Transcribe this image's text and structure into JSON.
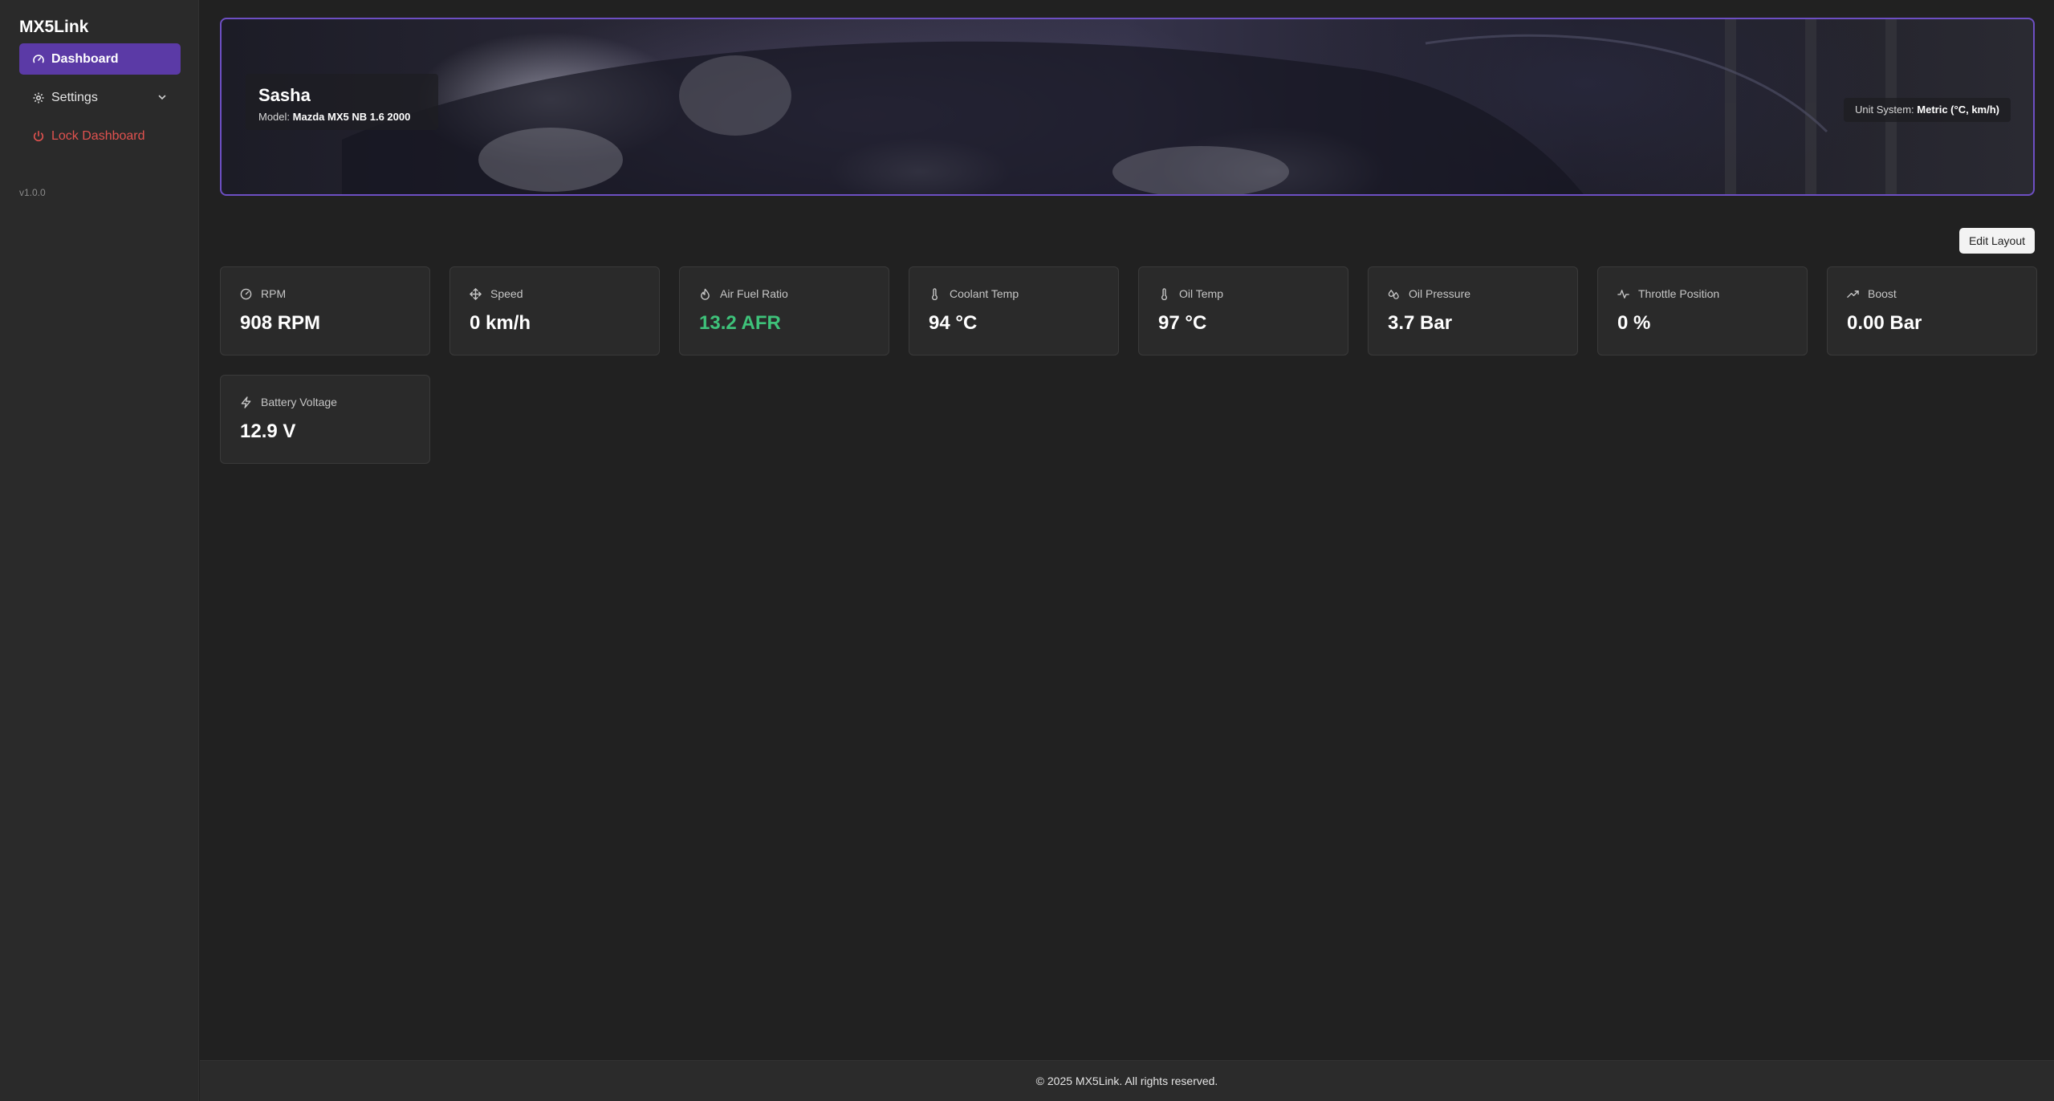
{
  "sidebar": {
    "brand": "MX5Link",
    "items": [
      {
        "label": "Dashboard",
        "icon": "gauge-icon"
      },
      {
        "label": "Settings",
        "icon": "gear-icon"
      },
      {
        "label": "Lock Dashboard",
        "icon": "power-icon"
      }
    ],
    "version": "v1.0.0"
  },
  "hero": {
    "name": "Sasha",
    "model_label": "Model:",
    "model_value": "Mazda MX5 NB 1.6 2000",
    "units_label": "Unit System:",
    "units_value": "Metric (°C, km/h)"
  },
  "toolbar": {
    "edit_layout": "Edit Layout"
  },
  "metrics": [
    {
      "label": "RPM",
      "value": "908 RPM",
      "icon": "gauge-icon"
    },
    {
      "label": "Speed",
      "value": "0 km/h",
      "icon": "move-icon"
    },
    {
      "label": "Air Fuel Ratio",
      "value": "13.2 AFR",
      "icon": "flame-icon",
      "value_color": "#3ec27a"
    },
    {
      "label": "Coolant Temp",
      "value": "94 °C",
      "icon": "thermometer-icon"
    },
    {
      "label": "Oil Temp",
      "value": "97 °C",
      "icon": "thermometer-icon"
    },
    {
      "label": "Oil Pressure",
      "value": "3.7 Bar",
      "icon": "droplets-icon"
    },
    {
      "label": "Throttle Position",
      "value": "0 %",
      "icon": "activity-icon"
    },
    {
      "label": "Boost",
      "value": "0.00 Bar",
      "icon": "trending-up-icon"
    },
    {
      "label": "Battery Voltage",
      "value": "12.9 V",
      "icon": "zap-icon"
    }
  ],
  "footer": {
    "copyright": "© 2025 MX5Link. All rights reserved."
  },
  "colors": {
    "accent": "#5b3aa6",
    "danger": "#e0524f",
    "good": "#3ec27a",
    "hero_border": "#6d4fc3"
  }
}
